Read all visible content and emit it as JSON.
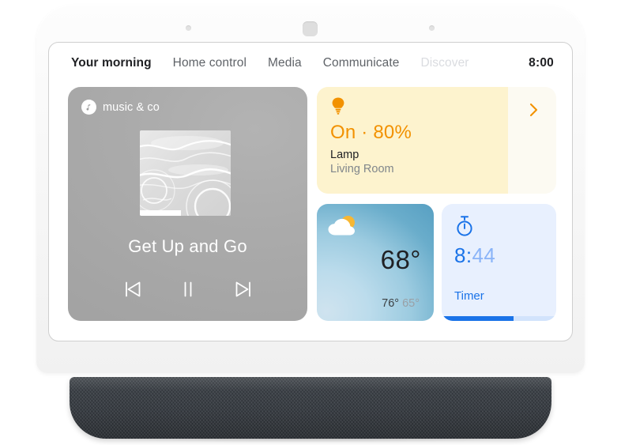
{
  "device": {
    "name": "smart-display",
    "sensors": [
      "sensor-dot-left",
      "camera-sensor",
      "sensor-dot-right"
    ]
  },
  "screen": {
    "topnav": {
      "tabs": [
        {
          "label": "Your morning",
          "state": "active"
        },
        {
          "label": "Home control",
          "state": "normal"
        },
        {
          "label": "Media",
          "state": "normal"
        },
        {
          "label": "Communicate",
          "state": "normal"
        },
        {
          "label": "Discover",
          "state": "dim"
        }
      ],
      "clock": "8:00"
    },
    "cards": {
      "music": {
        "provider": "music & co",
        "provider_icon": "music-note-icon",
        "track_title": "Get Up and Go",
        "controls": {
          "previous": "skip-previous-icon",
          "play_pause": "pause-icon",
          "next": "skip-next-icon"
        },
        "background_color": "#ababab",
        "text_color": "#ffffff"
      },
      "lamp": {
        "icon": "light-bulb-icon",
        "state": "On · 80%",
        "name": "Lamp",
        "room": "Living Room",
        "brightness_percent": 80,
        "chevron": "chevron-right-icon",
        "accent_color": "#f29100",
        "fill_color": "#fdf3ce",
        "track_color": "#fcfaf2"
      },
      "weather": {
        "icon": "partly-cloudy-icon",
        "current_temp": "68°",
        "high_temp": "76°",
        "low_temp": "65°",
        "gradient_from": "#cfe3ef",
        "gradient_to": "#5ba2c4"
      },
      "timer": {
        "icon": "stopwatch-icon",
        "value_main": "8:",
        "value_sub": "44",
        "label": "Timer",
        "progress_percent": 63,
        "accent_color": "#1a73e8",
        "background_color": "#e8f0fe"
      }
    }
  }
}
